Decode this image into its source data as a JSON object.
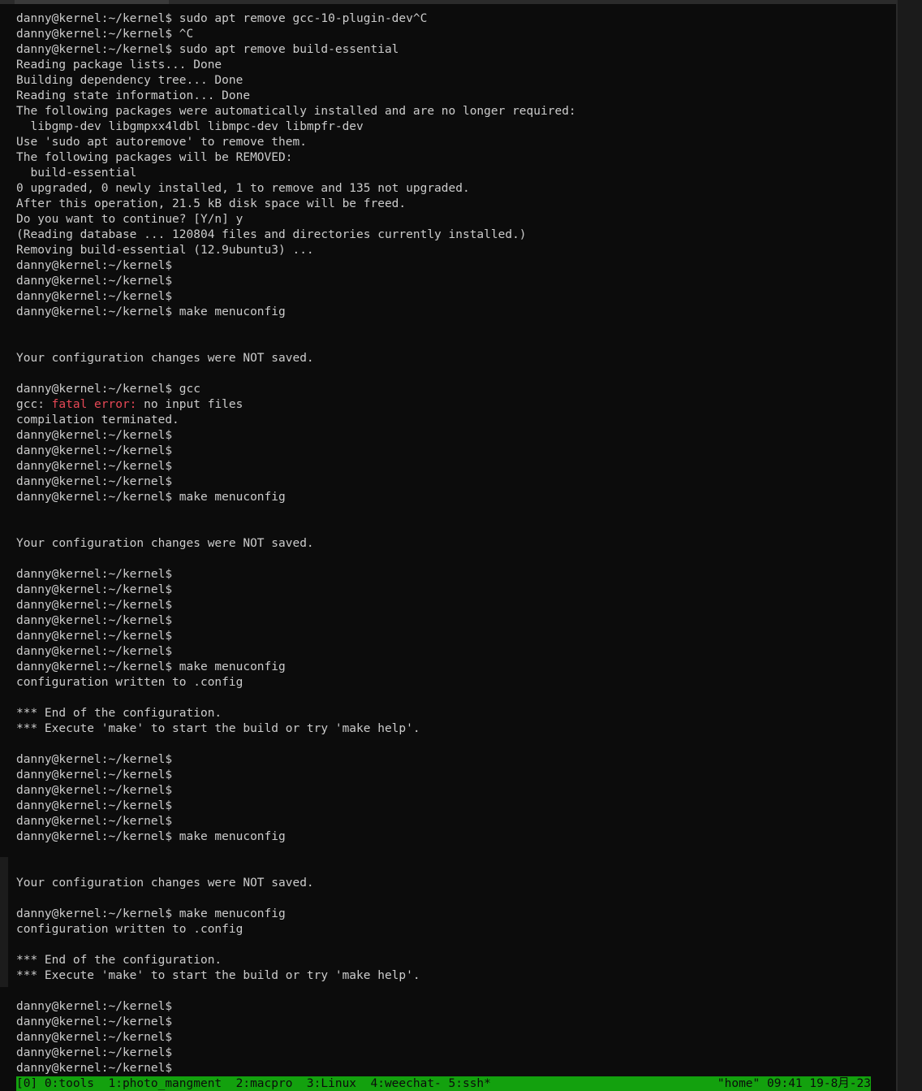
{
  "terminal": {
    "lines": [
      "danny@kernel:~/kernel$ sudo apt remove gcc-10-plugin-dev^C",
      "danny@kernel:~/kernel$ ^C",
      "danny@kernel:~/kernel$ sudo apt remove build-essential",
      "Reading package lists... Done",
      "Building dependency tree... Done",
      "Reading state information... Done",
      "The following packages were automatically installed and are no longer required:",
      "  libgmp-dev libgmpxx4ldbl libmpc-dev libmpfr-dev",
      "Use 'sudo apt autoremove' to remove them.",
      "The following packages will be REMOVED:",
      "  build-essential",
      "0 upgraded, 0 newly installed, 1 to remove and 135 not upgraded.",
      "After this operation, 21.5 kB disk space will be freed.",
      "Do you want to continue? [Y/n] y",
      "(Reading database ... 120804 files and directories currently installed.)",
      "Removing build-essential (12.9ubuntu3) ...",
      "danny@kernel:~/kernel$",
      "danny@kernel:~/kernel$",
      "danny@kernel:~/kernel$",
      "danny@kernel:~/kernel$ make menuconfig",
      "",
      "",
      "Your configuration changes were NOT saved.",
      "",
      "danny@kernel:~/kernel$ gcc",
      "__GCC_ERROR__",
      "compilation terminated.",
      "danny@kernel:~/kernel$",
      "danny@kernel:~/kernel$",
      "danny@kernel:~/kernel$",
      "danny@kernel:~/kernel$",
      "danny@kernel:~/kernel$ make menuconfig",
      "",
      "",
      "Your configuration changes were NOT saved.",
      "",
      "danny@kernel:~/kernel$",
      "danny@kernel:~/kernel$",
      "danny@kernel:~/kernel$",
      "danny@kernel:~/kernel$",
      "danny@kernel:~/kernel$",
      "danny@kernel:~/kernel$",
      "danny@kernel:~/kernel$ make menuconfig",
      "configuration written to .config",
      "",
      "*** End of the configuration.",
      "*** Execute 'make' to start the build or try 'make help'.",
      "",
      "danny@kernel:~/kernel$",
      "danny@kernel:~/kernel$",
      "danny@kernel:~/kernel$",
      "danny@kernel:~/kernel$",
      "danny@kernel:~/kernel$",
      "danny@kernel:~/kernel$ make menuconfig",
      "",
      "",
      "Your configuration changes were NOT saved.",
      "",
      "danny@kernel:~/kernel$ make menuconfig",
      "configuration written to .config",
      "",
      "*** End of the configuration.",
      "*** Execute 'make' to start the build or try 'make help'.",
      "",
      "danny@kernel:~/kernel$",
      "danny@kernel:~/kernel$",
      "danny@kernel:~/kernel$",
      "danny@kernel:~/kernel$",
      "danny@kernel:~/kernel$"
    ],
    "gcc_error": {
      "prefix": "gcc: ",
      "label": "fatal error:",
      "message": " no input files"
    }
  },
  "status_bar": {
    "left": "[0] 0:tools  1:photo_mangment  2:macpro  3:Linux  4:weechat- 5:ssh*",
    "right": "\"home\" 09:41 19-8月-23"
  },
  "colors": {
    "background": "#0c0c0c",
    "foreground": "#cccccc",
    "error": "#e74856",
    "status_bar": "#13a10e"
  }
}
